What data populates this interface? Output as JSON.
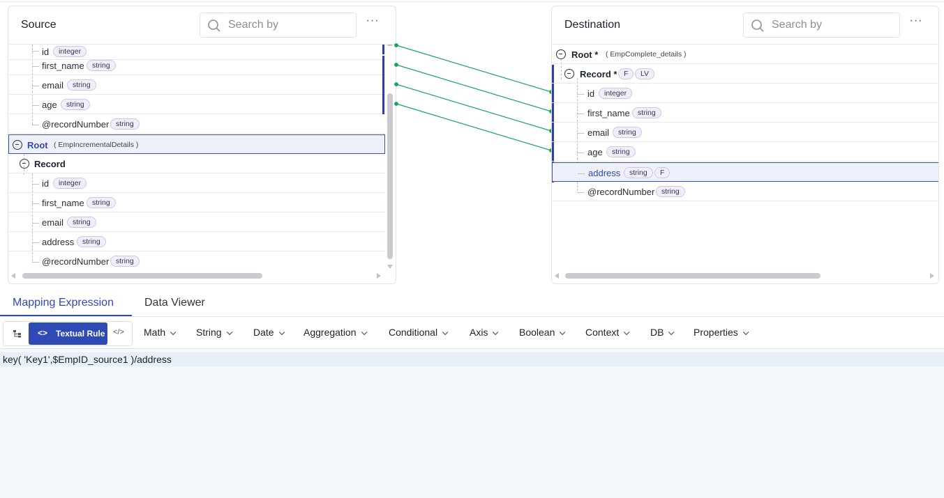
{
  "source": {
    "title": "Source",
    "search_placeholder": "Search by",
    "more": "···",
    "rows": [
      {
        "label": "id",
        "type": "integer"
      },
      {
        "label": "first_name",
        "type": "string"
      },
      {
        "label": "email",
        "type": "string"
      },
      {
        "label": "age",
        "type": "string"
      },
      {
        "label": "@recordNumber",
        "type": "string"
      },
      {
        "label": "Root",
        "note": "( EmpIncrementalDetails )"
      },
      {
        "label": "Record"
      },
      {
        "label": "id",
        "type": "integer"
      },
      {
        "label": "first_name",
        "type": "string"
      },
      {
        "label": "email",
        "type": "string"
      },
      {
        "label": "address",
        "type": "string"
      },
      {
        "label": "@recordNumber",
        "type": "string"
      }
    ]
  },
  "destination": {
    "title": "Destination",
    "search_placeholder": "Search by",
    "more": "···",
    "rows": [
      {
        "label": "Root *",
        "note": "( EmpComplete_details )"
      },
      {
        "label": "Record *",
        "badges": [
          "F",
          "LV"
        ]
      },
      {
        "label": "id",
        "type": "integer"
      },
      {
        "label": "first_name",
        "type": "string"
      },
      {
        "label": "email",
        "type": "string"
      },
      {
        "label": "age",
        "type": "string"
      },
      {
        "label": "address",
        "type": "string",
        "badges": [
          "F"
        ]
      },
      {
        "label": "@recordNumber",
        "type": "string"
      }
    ]
  },
  "tabs": [
    {
      "label": "Mapping Expression"
    },
    {
      "label": "Data Viewer"
    }
  ],
  "toolbar": {
    "mode_active": "Textual Rule",
    "mode_active_icon": "<>",
    "mode_code_icon": "</>",
    "menus": [
      "Math",
      "String",
      "Date",
      "Aggregation",
      "Conditional",
      "Axis",
      "Boolean",
      "Context",
      "DB",
      "Properties"
    ]
  },
  "editor": {
    "expression": "key( 'Key1',$EmpID_source1 )/address"
  },
  "colors": {
    "accent": "#2f49b5",
    "connector": "#1aa35a",
    "badge_bg": "#f1edfa"
  }
}
